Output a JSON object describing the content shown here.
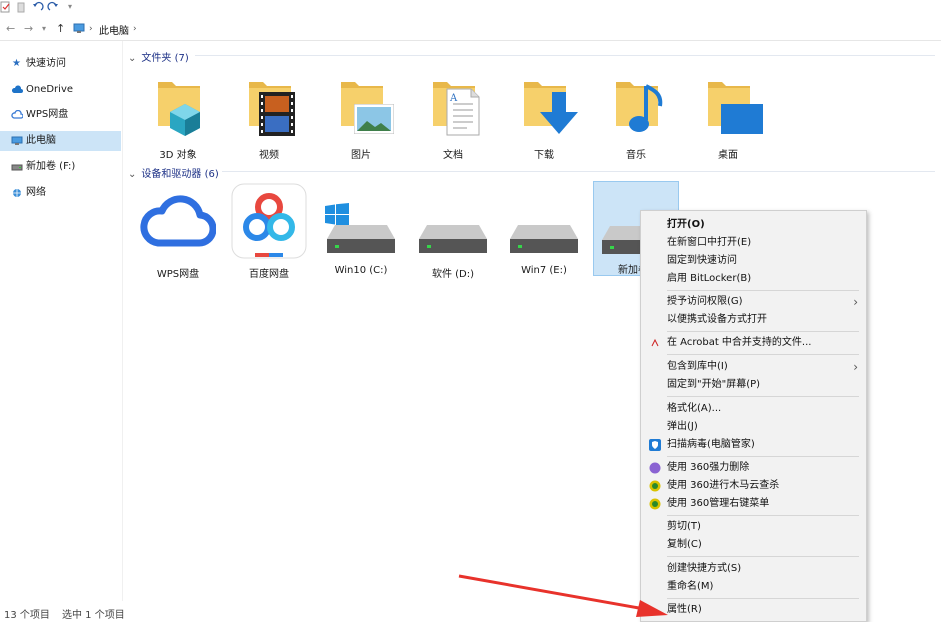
{
  "nav": {
    "breadcrumb": "此电脑"
  },
  "sidebar": {
    "items": [
      {
        "label": "快速访问"
      },
      {
        "label": "OneDrive"
      },
      {
        "label": "WPS网盘"
      },
      {
        "label": "此电脑"
      },
      {
        "label": "新加卷 (F:)"
      },
      {
        "label": "网络"
      }
    ]
  },
  "folders": {
    "header": "文件夹 (7)",
    "items": [
      "3D 对象",
      "视频",
      "图片",
      "文档",
      "下载",
      "音乐",
      "桌面"
    ]
  },
  "devices": {
    "header": "设备和驱动器 (6)",
    "items": [
      "WPS网盘",
      "百度网盘",
      "Win10 (C:)",
      "软件 (D:)",
      "Win7 (E:)",
      "新加卷"
    ]
  },
  "status": {
    "count": "13 个项目",
    "selected": "选中 1 个项目"
  },
  "context_menu": {
    "items": [
      "打开(O)",
      "在新窗口中打开(E)",
      "固定到快速访问",
      "启用 BitLocker(B)",
      "授予访问权限(G)",
      "以便携式设备方式打开",
      "在 Acrobat 中合并支持的文件...",
      "包含到库中(I)",
      "固定到\"开始\"屏幕(P)",
      "格式化(A)...",
      "弹出(J)",
      "扫描病毒(电脑管家)",
      "使用 360强力删除",
      "使用 360进行木马云查杀",
      "使用 360管理右键菜单",
      "剪切(T)",
      "复制(C)",
      "创建快捷方式(S)",
      "重命名(M)",
      "属性(R)"
    ]
  },
  "colors": {
    "folder": "#f3c859",
    "selection": "#cce4f7",
    "accent": "#0078d7",
    "arrow": "#e8322b"
  }
}
